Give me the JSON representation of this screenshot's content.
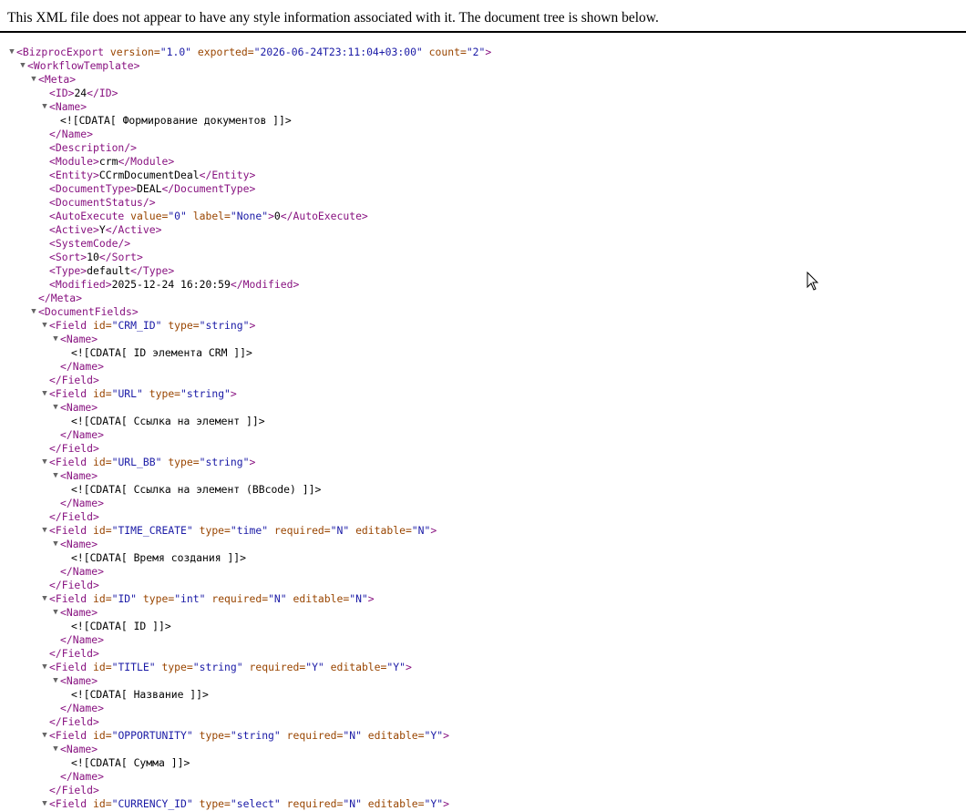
{
  "header": {
    "message": "This XML file does not appear to have any style information associated with it. The document tree is shown below."
  },
  "tree_lines": [
    {
      "indent": 0,
      "toggle": true,
      "tag": "BizprocExport",
      "kind": "open",
      "attrs": [
        {
          "name": "version",
          "value": "1.0"
        },
        {
          "name": "exported",
          "value": "2026-06-24T23:11:04+03:00"
        },
        {
          "name": "count",
          "value": "2"
        }
      ]
    },
    {
      "indent": 1,
      "toggle": true,
      "tag": "WorkflowTemplate",
      "kind": "open"
    },
    {
      "indent": 2,
      "toggle": true,
      "tag": "Meta",
      "kind": "open"
    },
    {
      "indent": 3,
      "tag": "ID",
      "kind": "inline",
      "text": "24"
    },
    {
      "indent": 3,
      "toggle": true,
      "tag": "Name",
      "kind": "open"
    },
    {
      "indent": 4,
      "kind": "text",
      "text": "<![CDATA[ Формирование документов ]]>"
    },
    {
      "indent": 3,
      "tag": "Name",
      "kind": "close"
    },
    {
      "indent": 3,
      "tag": "Description",
      "kind": "empty"
    },
    {
      "indent": 3,
      "tag": "Module",
      "kind": "inline",
      "text": "crm"
    },
    {
      "indent": 3,
      "tag": "Entity",
      "kind": "inline",
      "text": "CCrmDocumentDeal"
    },
    {
      "indent": 3,
      "tag": "DocumentType",
      "kind": "inline",
      "text": "DEAL"
    },
    {
      "indent": 3,
      "tag": "DocumentStatus",
      "kind": "empty"
    },
    {
      "indent": 3,
      "tag": "AutoExecute",
      "kind": "inline",
      "text": "0",
      "attrs": [
        {
          "name": "value",
          "value": "0"
        },
        {
          "name": "label",
          "value": "None"
        }
      ]
    },
    {
      "indent": 3,
      "tag": "Active",
      "kind": "inline",
      "text": "Y"
    },
    {
      "indent": 3,
      "tag": "SystemCode",
      "kind": "empty"
    },
    {
      "indent": 3,
      "tag": "Sort",
      "kind": "inline",
      "text": "10"
    },
    {
      "indent": 3,
      "tag": "Type",
      "kind": "inline",
      "text": "default"
    },
    {
      "indent": 3,
      "tag": "Modified",
      "kind": "inline",
      "text": "2025-12-24 16:20:59"
    },
    {
      "indent": 2,
      "tag": "Meta",
      "kind": "close"
    },
    {
      "indent": 2,
      "toggle": true,
      "tag": "DocumentFields",
      "kind": "open"
    },
    {
      "indent": 3,
      "toggle": true,
      "tag": "Field",
      "kind": "open",
      "attrs": [
        {
          "name": "id",
          "value": "CRM_ID"
        },
        {
          "name": "type",
          "value": "string"
        }
      ]
    },
    {
      "indent": 4,
      "toggle": true,
      "tag": "Name",
      "kind": "open"
    },
    {
      "indent": 5,
      "kind": "text",
      "text": "<![CDATA[ ID элемента CRM ]]>"
    },
    {
      "indent": 4,
      "tag": "Name",
      "kind": "close"
    },
    {
      "indent": 3,
      "tag": "Field",
      "kind": "close"
    },
    {
      "indent": 3,
      "toggle": true,
      "tag": "Field",
      "kind": "open",
      "attrs": [
        {
          "name": "id",
          "value": "URL"
        },
        {
          "name": "type",
          "value": "string"
        }
      ]
    },
    {
      "indent": 4,
      "toggle": true,
      "tag": "Name",
      "kind": "open"
    },
    {
      "indent": 5,
      "kind": "text",
      "text": "<![CDATA[ Ссылка на элемент ]]>"
    },
    {
      "indent": 4,
      "tag": "Name",
      "kind": "close"
    },
    {
      "indent": 3,
      "tag": "Field",
      "kind": "close"
    },
    {
      "indent": 3,
      "toggle": true,
      "tag": "Field",
      "kind": "open",
      "attrs": [
        {
          "name": "id",
          "value": "URL_BB"
        },
        {
          "name": "type",
          "value": "string"
        }
      ]
    },
    {
      "indent": 4,
      "toggle": true,
      "tag": "Name",
      "kind": "open"
    },
    {
      "indent": 5,
      "kind": "text",
      "text": "<![CDATA[ Ссылка на элемент (BBcode) ]]>"
    },
    {
      "indent": 4,
      "tag": "Name",
      "kind": "close"
    },
    {
      "indent": 3,
      "tag": "Field",
      "kind": "close"
    },
    {
      "indent": 3,
      "toggle": true,
      "tag": "Field",
      "kind": "open",
      "attrs": [
        {
          "name": "id",
          "value": "TIME_CREATE"
        },
        {
          "name": "type",
          "value": "time"
        },
        {
          "name": "required",
          "value": "N"
        },
        {
          "name": "editable",
          "value": "N"
        }
      ]
    },
    {
      "indent": 4,
      "toggle": true,
      "tag": "Name",
      "kind": "open"
    },
    {
      "indent": 5,
      "kind": "text",
      "text": "<![CDATA[ Время создания ]]>"
    },
    {
      "indent": 4,
      "tag": "Name",
      "kind": "close"
    },
    {
      "indent": 3,
      "tag": "Field",
      "kind": "close"
    },
    {
      "indent": 3,
      "toggle": true,
      "tag": "Field",
      "kind": "open",
      "attrs": [
        {
          "name": "id",
          "value": "ID"
        },
        {
          "name": "type",
          "value": "int"
        },
        {
          "name": "required",
          "value": "N"
        },
        {
          "name": "editable",
          "value": "N"
        }
      ]
    },
    {
      "indent": 4,
      "toggle": true,
      "tag": "Name",
      "kind": "open"
    },
    {
      "indent": 5,
      "kind": "text",
      "text": "<![CDATA[ ID ]]>"
    },
    {
      "indent": 4,
      "tag": "Name",
      "kind": "close"
    },
    {
      "indent": 3,
      "tag": "Field",
      "kind": "close"
    },
    {
      "indent": 3,
      "toggle": true,
      "tag": "Field",
      "kind": "open",
      "attrs": [
        {
          "name": "id",
          "value": "TITLE"
        },
        {
          "name": "type",
          "value": "string"
        },
        {
          "name": "required",
          "value": "Y"
        },
        {
          "name": "editable",
          "value": "Y"
        }
      ]
    },
    {
      "indent": 4,
      "toggle": true,
      "tag": "Name",
      "kind": "open"
    },
    {
      "indent": 5,
      "kind": "text",
      "text": "<![CDATA[ Название ]]>"
    },
    {
      "indent": 4,
      "tag": "Name",
      "kind": "close"
    },
    {
      "indent": 3,
      "tag": "Field",
      "kind": "close"
    },
    {
      "indent": 3,
      "toggle": true,
      "tag": "Field",
      "kind": "open",
      "attrs": [
        {
          "name": "id",
          "value": "OPPORTUNITY"
        },
        {
          "name": "type",
          "value": "string"
        },
        {
          "name": "required",
          "value": "N"
        },
        {
          "name": "editable",
          "value": "Y"
        }
      ]
    },
    {
      "indent": 4,
      "toggle": true,
      "tag": "Name",
      "kind": "open"
    },
    {
      "indent": 5,
      "kind": "text",
      "text": "<![CDATA[ Сумма ]]>"
    },
    {
      "indent": 4,
      "tag": "Name",
      "kind": "close"
    },
    {
      "indent": 3,
      "tag": "Field",
      "kind": "close"
    },
    {
      "indent": 3,
      "toggle": true,
      "tag": "Field",
      "kind": "open",
      "attrs": [
        {
          "name": "id",
          "value": "CURRENCY_ID"
        },
        {
          "name": "type",
          "value": "select"
        },
        {
          "name": "required",
          "value": "N"
        },
        {
          "name": "editable",
          "value": "Y"
        }
      ]
    }
  ]
}
